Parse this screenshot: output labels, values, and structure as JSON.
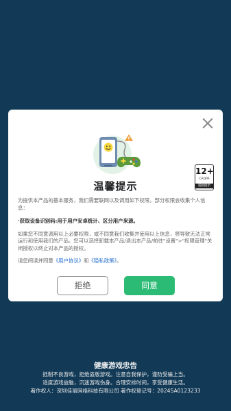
{
  "dialog": {
    "title": "温馨提示",
    "close_icon": "close-icon",
    "age_rating": {
      "number": "12+",
      "label": "CADPA",
      "sub_label": "适龄提示"
    },
    "paragraph1": "为提供本产品的基本服务，我们需要联网以及调用如下权限，部分权限会收集个人信息：",
    "paragraph2": "·获取设备识别码:用于用户安卓统计、区分用户来源。",
    "paragraph3": "如果您不同意调用以上必要权限，或不同意我们收集并使用以上信息，将导致无法正常运行和使用我们的产品。您可以选择卸载本产品/退出本产品/前往\"设置\">\"权限管理\"关闭授权以终止对本产品的授权。",
    "paragraph4_prefix": "请您阅读并同意",
    "user_agreement_link": "《用户协议》",
    "paragraph4_and": "和",
    "privacy_policy_link": "《隐私政策》",
    "paragraph4_suffix": "。",
    "refuse_label": "拒绝",
    "agree_label": "同意"
  },
  "footer": {
    "title": "健康游戏忠告",
    "line1": "抵制不良游戏，拒绝盗版游戏。注意自我保护，谨防受骗上当。",
    "line2": "适度游戏益脑，沉迷游戏伤身。合理安排时间，享受健康生活。",
    "line3": "著作权人：深圳佳丽网络科技有限公司  著作权登记号：2024SA0123233"
  },
  "colors": {
    "background": "#123a57",
    "agree_button": "#2bbb75",
    "link": "#1f6ecf"
  }
}
